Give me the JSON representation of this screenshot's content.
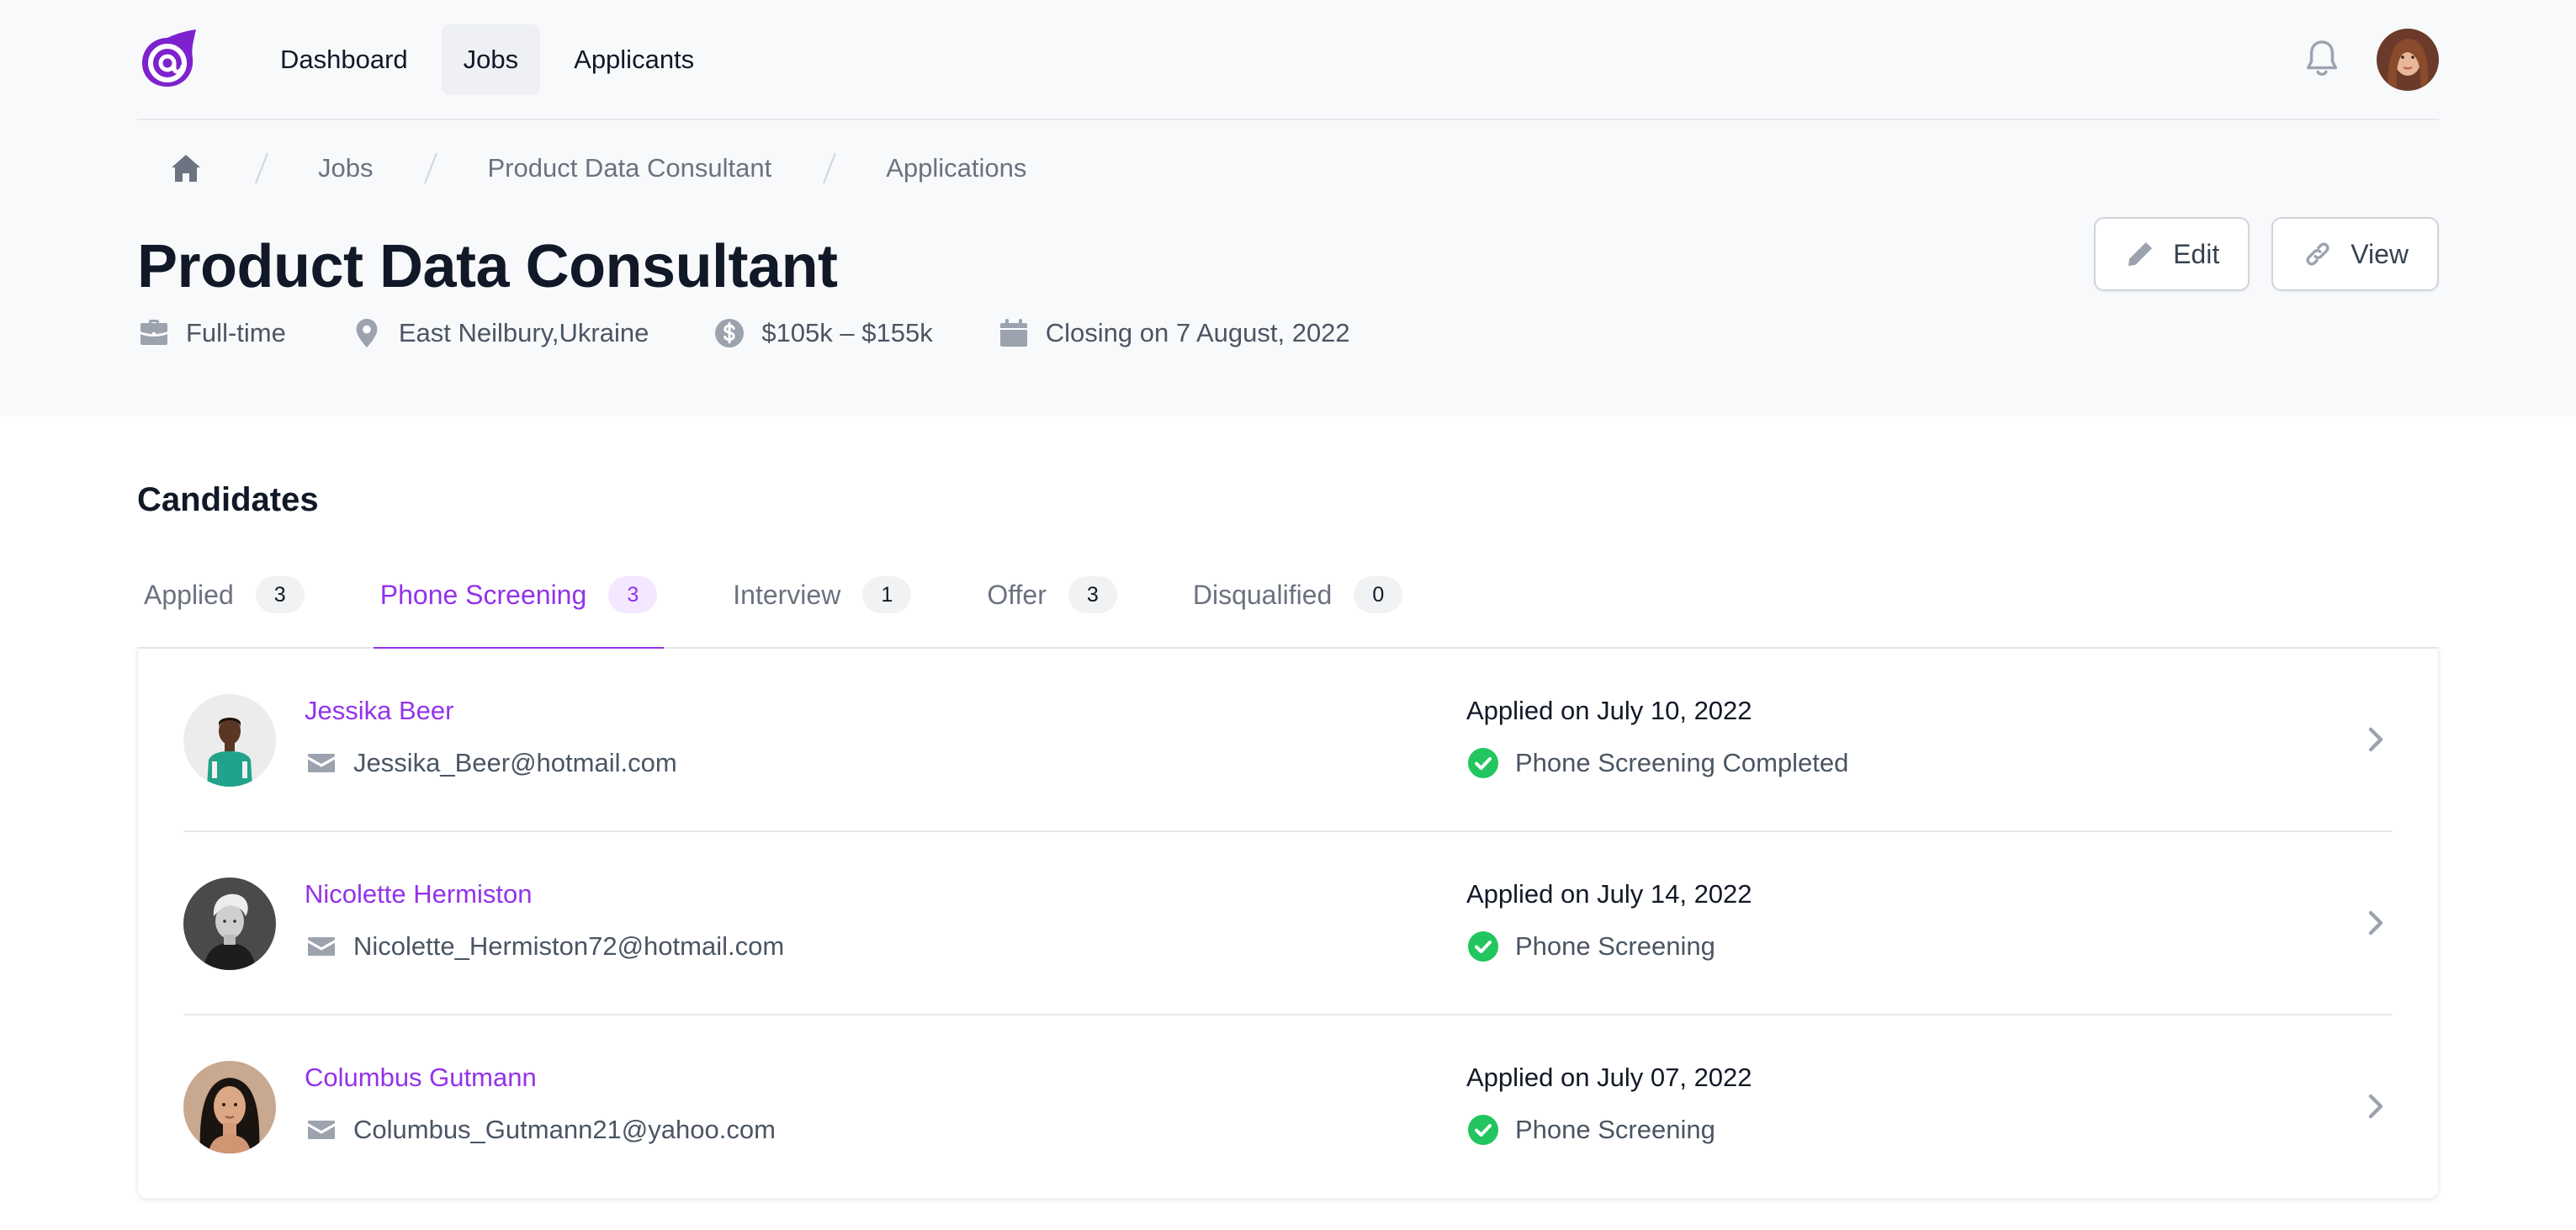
{
  "nav": {
    "items": [
      {
        "label": "Dashboard",
        "active": false
      },
      {
        "label": "Jobs",
        "active": true
      },
      {
        "label": "Applicants",
        "active": false
      }
    ]
  },
  "breadcrumb": {
    "items": [
      "Jobs",
      "Product Data Consultant",
      "Applications"
    ]
  },
  "job": {
    "title": "Product Data Consultant",
    "type": "Full-time",
    "location": "East Neilbury,Ukraine",
    "salary": "$105k – $155k",
    "closing": "Closing on 7 August, 2022"
  },
  "actions": {
    "edit_label": "Edit",
    "view_label": "View"
  },
  "candidates": {
    "title": "Candidates",
    "tabs": [
      {
        "label": "Applied",
        "count": "3",
        "active": false
      },
      {
        "label": "Phone Screening",
        "count": "3",
        "active": true
      },
      {
        "label": "Interview",
        "count": "1",
        "active": false
      },
      {
        "label": "Offer",
        "count": "3",
        "active": false
      },
      {
        "label": "Disqualified",
        "count": "0",
        "active": false
      }
    ],
    "rows": [
      {
        "name": "Jessika Beer",
        "email": "Jessika_Beer@hotmail.com",
        "applied": "Applied on July 10, 2022",
        "status": "Phone Screening Completed"
      },
      {
        "name": "Nicolette Hermiston",
        "email": "Nicolette_Hermiston72@hotmail.com",
        "applied": "Applied on July 14, 2022",
        "status": "Phone Screening"
      },
      {
        "name": "Columbus Gutmann",
        "email": "Columbus_Gutmann21@yahoo.com",
        "applied": "Applied on July 07, 2022",
        "status": "Phone Screening"
      }
    ]
  },
  "colors": {
    "accent": "#9333ea",
    "success": "#22c55e",
    "muted": "#6b7280"
  }
}
